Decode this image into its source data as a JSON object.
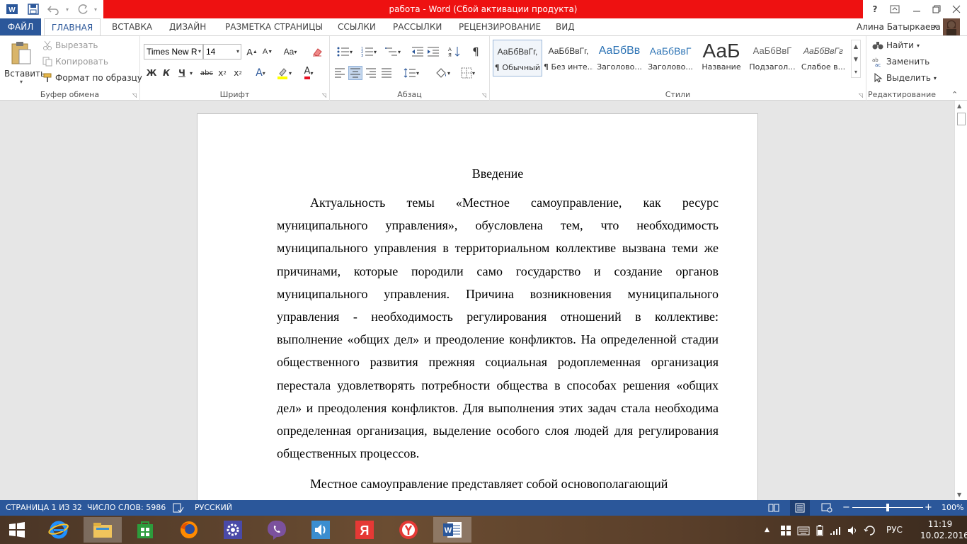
{
  "window": {
    "title": "работа -  Word (Сбой активации продукта)"
  },
  "quick_access": {
    "save": "save-icon",
    "undo": "undo-icon",
    "redo": "redo-icon"
  },
  "window_controls": {
    "help": "?"
  },
  "tabs": [
    {
      "label": "ФАЙЛ"
    },
    {
      "label": "ГЛАВНАЯ"
    },
    {
      "label": "ВСТАВКА"
    },
    {
      "label": "ДИЗАЙН"
    },
    {
      "label": "РАЗМЕТКА СТРАНИЦЫ"
    },
    {
      "label": "ССЫЛКИ"
    },
    {
      "label": "РАССЫЛКИ"
    },
    {
      "label": "РЕЦЕНЗИРОВАНИЕ"
    },
    {
      "label": "ВИД"
    }
  ],
  "user": {
    "name": "Алина Батыркаева"
  },
  "clipboard": {
    "paste": "Вставить",
    "cut": "Вырезать",
    "copy": "Копировать",
    "format_painter": "Формат по образцу",
    "group_label": "Буфер обмена"
  },
  "font": {
    "name": "Times New R",
    "size": "14",
    "grow": "A",
    "shrink": "A",
    "case": "Aa",
    "bold": "Ж",
    "italic": "К",
    "underline": "Ч",
    "strike": "abc",
    "subscript": "x",
    "superscript": "x",
    "sub_mark": "2",
    "sup_mark": "2",
    "effects": "A",
    "color_letter": "A",
    "group_label": "Шрифт",
    "highlight_color": "#ffff00",
    "font_color": "#e81123"
  },
  "paragraph": {
    "group_label": "Абзац",
    "pilcrow": "¶"
  },
  "styles": {
    "group_label": "Стили",
    "items": [
      {
        "preview": "АаБбВвГг,",
        "name": "¶ Обычный"
      },
      {
        "preview": "АаБбВвГг,",
        "name": "¶ Без инте..."
      },
      {
        "preview": "АаБбВв",
        "name": "Заголово..."
      },
      {
        "preview": "АаБбВвГ",
        "name": "Заголово..."
      },
      {
        "preview": "АаБ",
        "name": "Название"
      },
      {
        "preview": "АаБбВвГ",
        "name": "Подзагол..."
      },
      {
        "preview": "АаБбВвГг",
        "name": "Слабое в..."
      }
    ]
  },
  "editing": {
    "find": "Найти",
    "replace": "Заменить",
    "select": "Выделить",
    "group_label": "Редактирование"
  },
  "document": {
    "heading": "Введение",
    "paragraphs": [
      "Актуальность темы «Местное самоуправление, как ресурс муниципального управления», обусловлена тем, что необходимость муниципального управления в территориальном коллективе вызвана теми же причинами, которые породили само государство и создание органов муниципального управления. Причина возникновения муниципального управления - необходимость регулирования отношений в коллективе: выполнение «общих дел» и преодоление конфликтов. На определенной стадии общественного развития прежняя социальная родоплеменная организация перестала удовлетворять потребности общества в способах решения «общих дел» и преодоления конфликтов. Для выполнения этих задач стала необходима определенная организация, выделение особого слоя людей для регулирования общественных процессов.",
      "Местное самоуправление представляет собой основополагающий"
    ]
  },
  "status": {
    "page": "СТРАНИЦА 1 ИЗ 32",
    "words": "ЧИСЛО СЛОВ: 5986",
    "language": "РУССКИЙ",
    "zoom": "100%",
    "zoom_minus": "−",
    "zoom_plus": "+"
  },
  "taskbar": {
    "apps": [
      "windows-start",
      "internet-explorer",
      "file-explorer",
      "store",
      "firefox",
      "settings",
      "viber",
      "volume-app",
      "yandex",
      "yandex-browser",
      "word"
    ],
    "yandex_letter": "Я",
    "word_letter": "W",
    "lang": "РУС",
    "time": "11:19",
    "date": "10.02.2016"
  },
  "colors": {
    "accent": "#2b579a",
    "title_red": "#ee1111"
  }
}
